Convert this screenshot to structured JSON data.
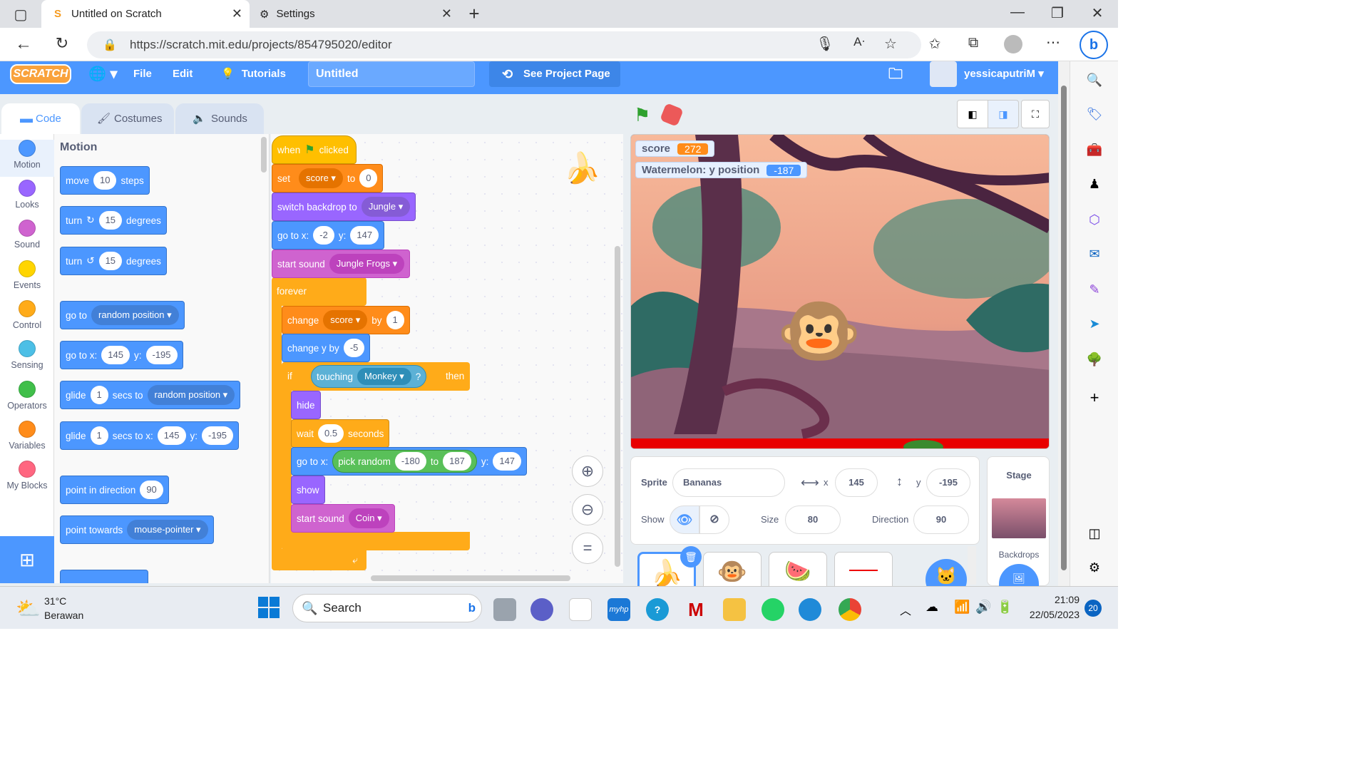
{
  "browser": {
    "tabs": [
      {
        "title": "Untitled on Scratch"
      },
      {
        "title": "Settings"
      }
    ],
    "url": "https://scratch.mit.edu/projects/854795020/editor"
  },
  "menu": {
    "file": "File",
    "edit": "Edit",
    "tutorials": "Tutorials",
    "project_title": "Untitled",
    "see_project": "See Project Page",
    "username": "yessicaputriM",
    "logo": "SCRATCH"
  },
  "tabs": {
    "code": "Code",
    "costumes": "Costumes",
    "sounds": "Sounds"
  },
  "categories": [
    {
      "label": "Motion",
      "color": "#4c97ff"
    },
    {
      "label": "Looks",
      "color": "#9966ff"
    },
    {
      "label": "Sound",
      "color": "#cf63cf"
    },
    {
      "label": "Events",
      "color": "#ffd500"
    },
    {
      "label": "Control",
      "color": "#ffab19"
    },
    {
      "label": "Sensing",
      "color": "#4cbfe6"
    },
    {
      "label": "Operators",
      "color": "#40bf4a"
    },
    {
      "label": "Variables",
      "color": "#ff8c1a"
    },
    {
      "label": "My Blocks",
      "color": "#ff6680"
    }
  ],
  "palette": {
    "heading": "Motion",
    "move": {
      "a": "move",
      "n": "10",
      "b": "steps"
    },
    "turn_cw": {
      "a": "turn",
      "n": "15",
      "b": "degrees"
    },
    "turn_ccw": {
      "a": "turn",
      "n": "15",
      "b": "degrees"
    },
    "goto": {
      "a": "go to",
      "d": "random position"
    },
    "gotoxy": {
      "a": "go to x:",
      "x": "145",
      "y_lbl": "y:",
      "y": "-195"
    },
    "glide1": {
      "a": "glide",
      "n": "1",
      "b": "secs to",
      "d": "random position"
    },
    "glide2": {
      "a": "glide",
      "n": "1",
      "b": "secs to x:",
      "x": "145",
      "y_lbl": "y:",
      "y": "-195"
    },
    "point_dir": {
      "a": "point in direction",
      "n": "90"
    },
    "point_towards": {
      "a": "point towards",
      "d": "mouse-pointer"
    }
  },
  "script": {
    "when_a": "when",
    "when_b": "clicked",
    "set": {
      "a": "set",
      "var": "score",
      "b": "to",
      "v": "0"
    },
    "backdrop": {
      "a": "switch backdrop to",
      "d": "Jungle"
    },
    "goto": {
      "a": "go to x:",
      "x": "-2",
      "y_lbl": "y:",
      "y": "147"
    },
    "sound1": {
      "a": "start sound",
      "d": "Jungle Frogs"
    },
    "forever": "forever",
    "change": {
      "a": "change",
      "var": "score",
      "b": "by",
      "v": "1"
    },
    "changey": {
      "a": "change y by",
      "v": "-5"
    },
    "if": {
      "a": "if",
      "touching": "touching",
      "obj": "Monkey",
      "q": "?",
      "then": "then"
    },
    "hide": "hide",
    "wait": {
      "a": "wait",
      "v": "0.5",
      "b": "seconds"
    },
    "goto2": {
      "a": "go to x:",
      "rand": "pick random",
      "r1": "-180",
      "to": "to",
      "r2": "187",
      "y_lbl": "y:",
      "y": "147"
    },
    "show": "show",
    "sound2": {
      "a": "start sound",
      "d": "Coin"
    }
  },
  "stage": {
    "monitor1": {
      "label": "score",
      "value": "272"
    },
    "monitor2": {
      "label": "Watermelon: y position",
      "value": "-187"
    }
  },
  "sprite": {
    "label": "Sprite",
    "name": "Bananas",
    "x_lbl": "x",
    "x": "145",
    "y_lbl": "y",
    "y": "-195",
    "show": "Show",
    "size_lbl": "Size",
    "size": "80",
    "dir_lbl": "Direction",
    "dir": "90"
  },
  "stage_pane": {
    "title": "Stage",
    "backdrops": "Backdrops"
  },
  "taskbar": {
    "temp": "31°C",
    "weather": "Berawan",
    "search": "Search",
    "time": "21:09",
    "date": "22/05/2023",
    "badge": "20"
  }
}
